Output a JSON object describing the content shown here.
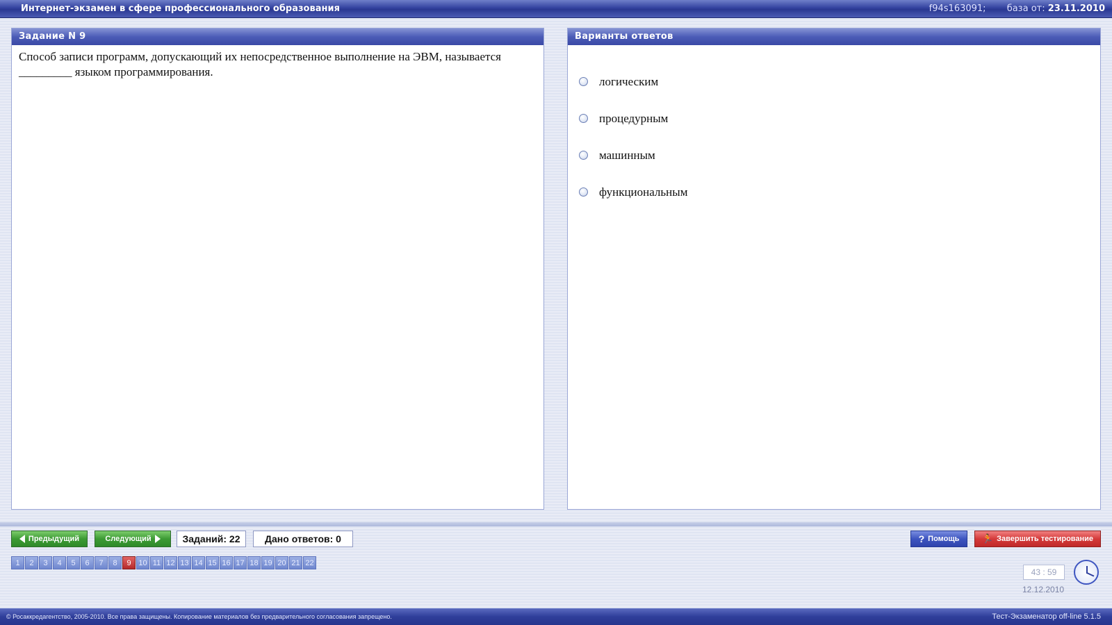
{
  "window": {
    "title": "Интернет-экзамен в сфере профессионального образования",
    "session_code": "f94s163091;",
    "db_label": "база от:",
    "db_date": "23.11.2010"
  },
  "question_panel": {
    "header": "Задание N 9",
    "text": "Способ записи программ, допускающий их непосредственное выполнение на ЭВМ, называется _________ языком программирования."
  },
  "answers_panel": {
    "header": "Варианты ответов",
    "options": [
      {
        "label": "логическим"
      },
      {
        "label": "процедурным"
      },
      {
        "label": "машинным"
      },
      {
        "label": "функциональным"
      }
    ]
  },
  "controls": {
    "prev_label": "Предыдущий",
    "next_label": "Следующий",
    "tasks_label": "Заданий: 22",
    "answered_label": "Дано ответов: 0",
    "help_label": "Помощь",
    "finish_label": "Завершить тестирование"
  },
  "pager": {
    "pages": [
      "1",
      "2",
      "3",
      "4",
      "5",
      "6",
      "7",
      "8",
      "9",
      "10",
      "11",
      "12",
      "13",
      "14",
      "15",
      "16",
      "17",
      "18",
      "19",
      "20",
      "21",
      "22"
    ],
    "active": "9"
  },
  "timer": {
    "value": "43 : 59",
    "date": "12.12.2010"
  },
  "footer": {
    "copyright": "© Росаккредагентство, 2005-2010. Все права защищены. Копирование материалов без предварительного согласования запрещено.",
    "version": "Тест-Экзаменатор off-line 5.1.5"
  },
  "colors": {
    "accent_blue": "#3443a0",
    "nav_green": "#3d9b35",
    "finish_red": "#d53a3a",
    "active_page": "#b52a2a"
  },
  "icons": {
    "prev": "arrow-left-icon",
    "next": "arrow-right-icon",
    "help": "question-mark-icon",
    "finish": "running-man-icon",
    "clock": "clock-icon"
  }
}
